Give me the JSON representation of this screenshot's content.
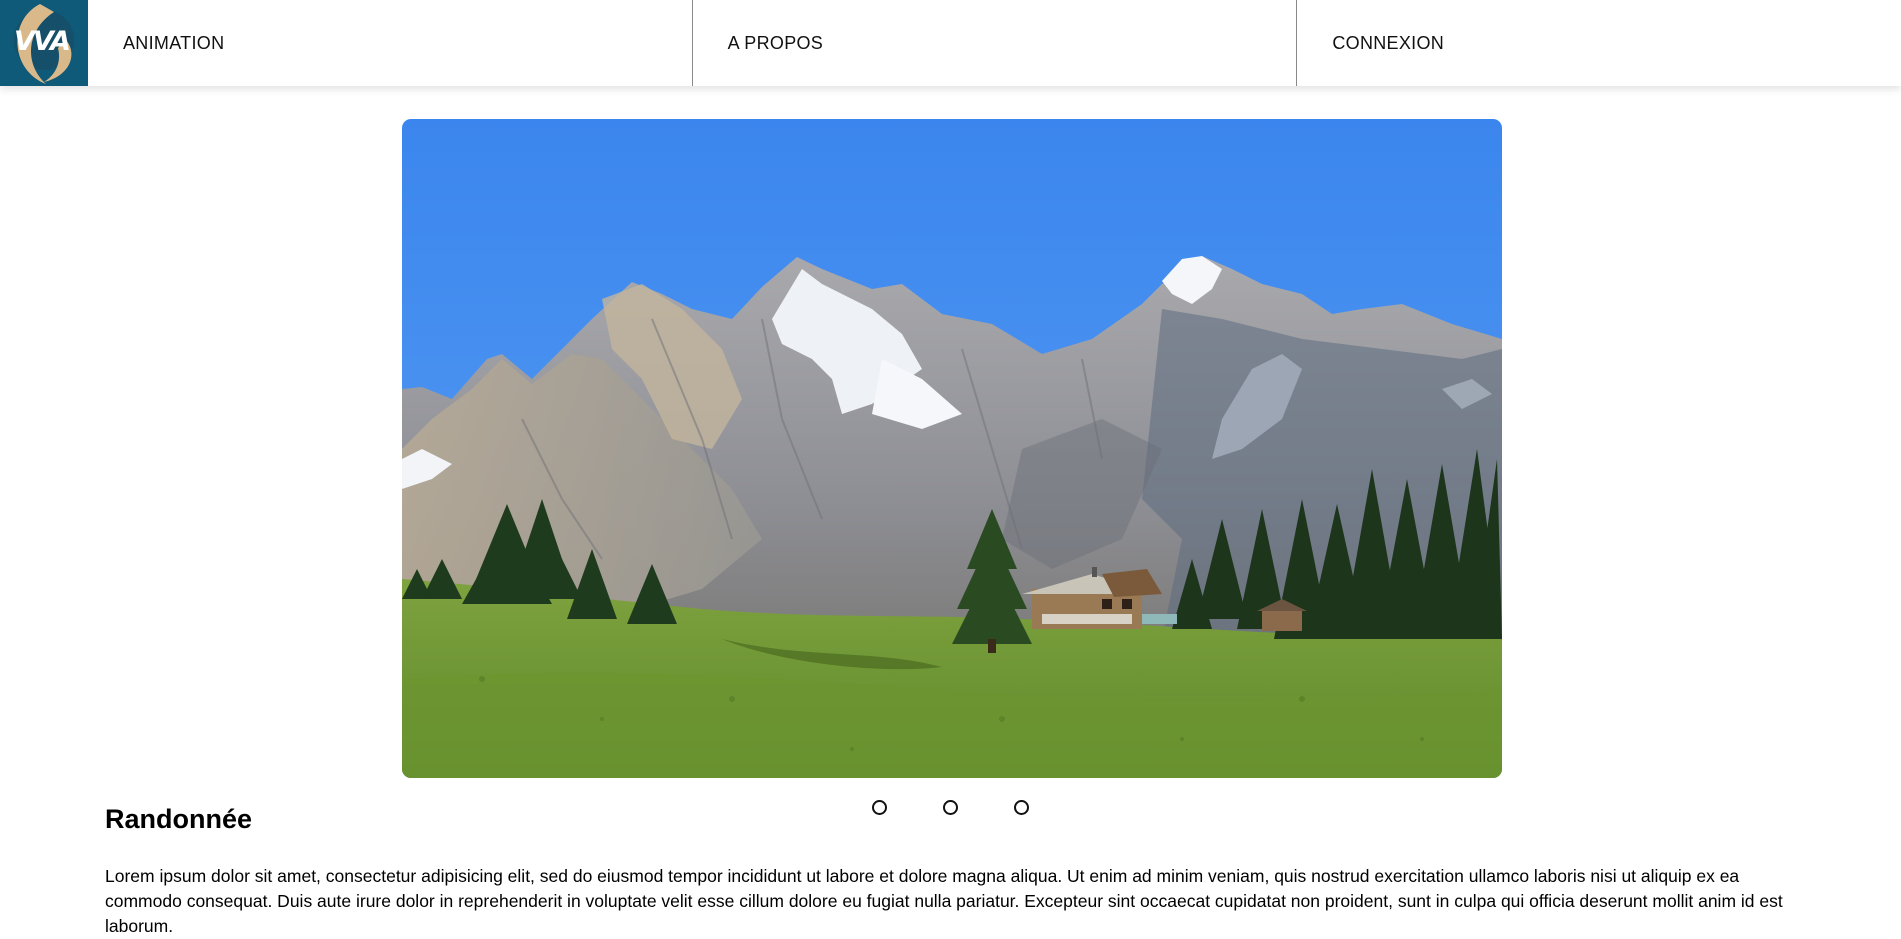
{
  "logo": {
    "text": "VVA",
    "icon": "vva-logo"
  },
  "nav": {
    "items": [
      {
        "label": "ANIMATION"
      },
      {
        "label": "A PROPOS"
      },
      {
        "label": "CONNEXION"
      }
    ]
  },
  "carousel": {
    "image_description": "mountain-landscape-photo",
    "slide_count": 3,
    "active_index": 0
  },
  "section": {
    "title": "Randonnée",
    "body": "Lorem ipsum dolor sit amet, consectetur adipisicing elit, sed do eiusmod tempor incididunt ut labore et dolore magna aliqua. Ut enim ad minim veniam, quis nostrud exercitation ullamco laboris nisi ut aliquip ex ea commodo consequat. Duis aute irure dolor in reprehenderit in voluptate velit esse cillum dolore eu fugiat nulla pariatur. Excepteur sint occaecat cupidatat non proident, sunt in culpa qui officia deserunt mollit anim id est laborum."
  },
  "colors": {
    "logo_bg": "#0e5a78",
    "logo_swoosh": "#d9b98a",
    "sky": "#3f8cf0",
    "grass": "#6f9a35"
  }
}
